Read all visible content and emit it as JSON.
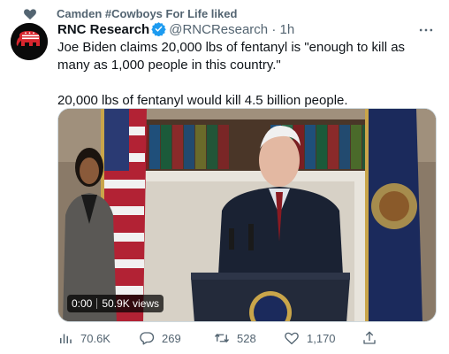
{
  "social_context": {
    "text": "Camden #Cowboys For Life liked",
    "icon": "heart-icon"
  },
  "tweet": {
    "display_name": "RNC Research",
    "handle": "@RNCResearch",
    "separator": "·",
    "time": "1h",
    "avatar_icon": "elephant-logo",
    "paragraphs": [
      "Joe Biden claims 20,000 lbs of fentanyl is \"enough to kill as many as 1,000 people in this country.\"",
      "20,000 lbs of fentanyl would kill 4.5 billion people."
    ]
  },
  "video": {
    "timestamp": "0:00",
    "views": "50.9K views"
  },
  "actions": {
    "views": "70.6K",
    "replies": "269",
    "retweets": "528",
    "likes": "1,170"
  },
  "colors": {
    "secondary_text": "#536471",
    "primary_text": "#0f1419",
    "verified": "#1d9bf0",
    "avatar_bg": "#0a0a0a",
    "logo_red": "#d8262e"
  }
}
